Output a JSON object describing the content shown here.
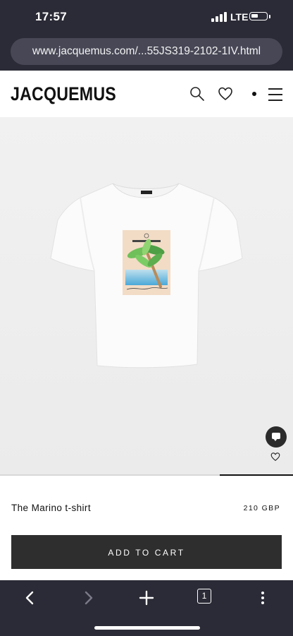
{
  "status_bar": {
    "time": "17:57",
    "network": "LTE",
    "icons": [
      "signal-icon",
      "battery-icon"
    ]
  },
  "browser": {
    "url": "www.jacquemus.com/...55JS319-2102-1IV.html",
    "tab_count": "1",
    "toolbar_icons": [
      "back-icon",
      "forward-icon",
      "new-tab-icon",
      "tabs-icon",
      "more-icon"
    ]
  },
  "header": {
    "logo": "JACQUEMUS",
    "icons": [
      "search-icon",
      "heart-icon",
      "dot-icon",
      "menu-icon"
    ]
  },
  "gallery": {
    "image_icon": "tshirt-image",
    "current_slide_fraction": [
      0.75,
      1.0
    ]
  },
  "product": {
    "name": "The Marino t-shirt",
    "price": "210 GBP",
    "add_to_cart_label": "ADD TO CART"
  },
  "colors": {
    "chrome": "#2b2b37",
    "button": "#2e2e2e",
    "hero_bg": "#eeeeee"
  }
}
